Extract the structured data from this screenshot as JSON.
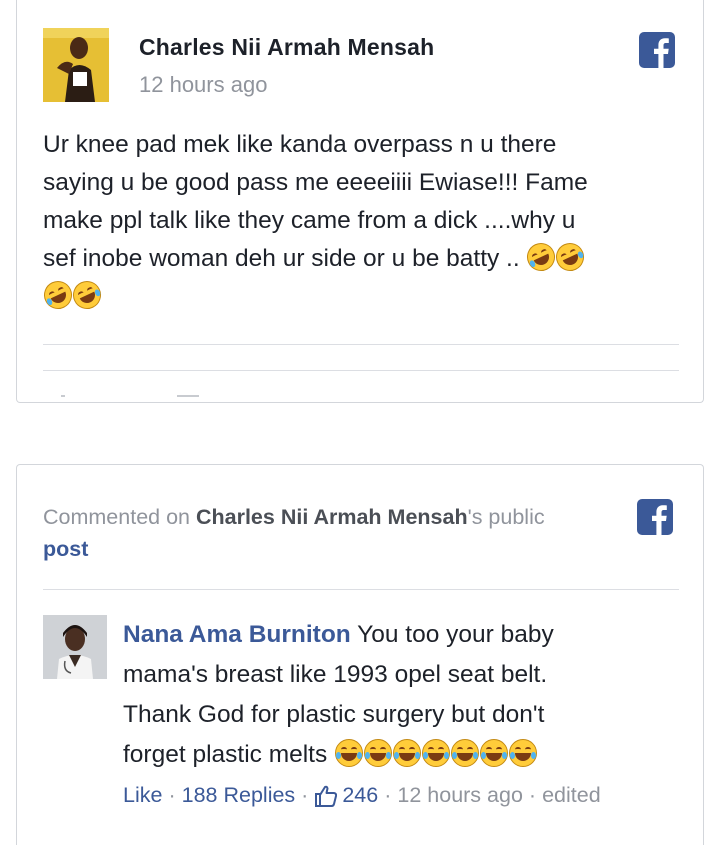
{
  "post": {
    "author": "Charles Nii Armah Mensah",
    "time": "12 hours ago",
    "text_line1": "Ur knee pad mek like kanda overpass n u there",
    "text_line2": "saying u be good pass me eeeeiiii Ewiase!!! Fame",
    "text_line3": "make ppl talk like they came from a dick ....why u",
    "text_line4": "sef inobe woman deh ur side or u be batty .. ",
    "emoji": "rolling-on-floor-laughing",
    "icon": "facebook-icon"
  },
  "comment_card": {
    "prefix": "Commented on ",
    "post_author": "Charles Nii Armah Mensah",
    "suffix": "'s public",
    "post_word": "post",
    "icon": "facebook-icon",
    "comment": {
      "author": "Nana Ama Burniton",
      "line1": " You too your baby",
      "line2": "mama's breast like 1993 opel seat belt.",
      "line3": "Thank God for plastic surgery but don't",
      "line4": "forget plastic melts ",
      "emoji": "face-with-tears-of-joy"
    },
    "actions": {
      "like": "Like",
      "replies": "188 Replies",
      "likes_count": "246",
      "time": "12 hours ago",
      "edited": "edited",
      "separator": "·"
    }
  },
  "colors": {
    "facebook_blue": "#3b5998",
    "text": "#1d2129",
    "muted": "#90949c",
    "border": "#d3d6db"
  }
}
